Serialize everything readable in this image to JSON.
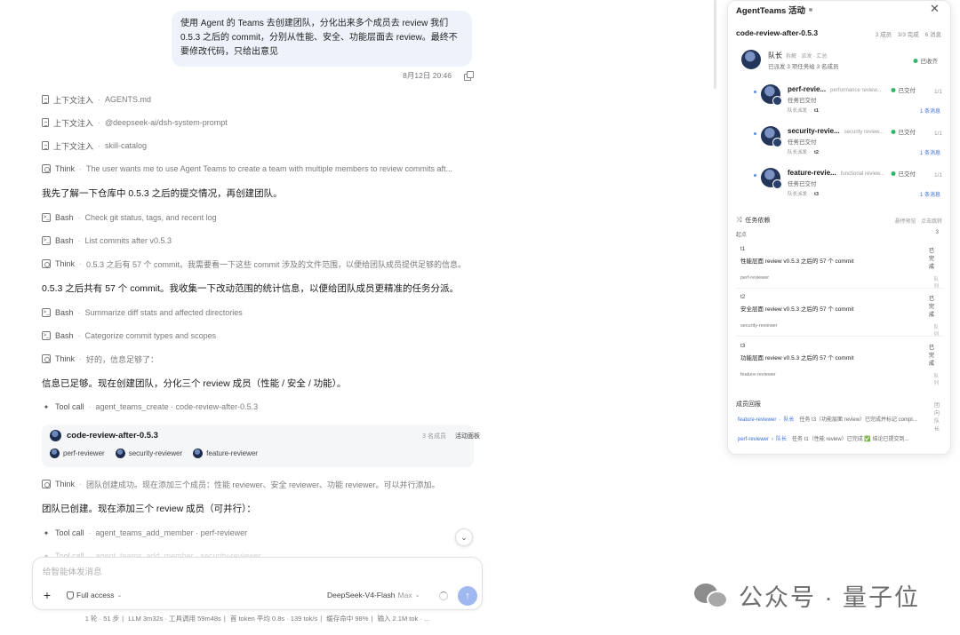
{
  "chat": {
    "user_message": "使用 Agent 的 Teams 去创建团队，分化出来多个成员去 review 我们 0.5.3 之后的 commit，分别从性能、安全、功能层面去 review。最终不要修改代码，只给出意见",
    "timestamp": "8月12日 20:46",
    "steps": [
      {
        "type": "context",
        "label": "上下文注入",
        "text": "AGENTS.md"
      },
      {
        "type": "context",
        "label": "上下文注入",
        "text": "@deepseek-ai/dsh-system-prompt"
      },
      {
        "type": "context",
        "label": "上下文注入",
        "text": "skill-catalog"
      },
      {
        "type": "think",
        "label": "Think",
        "text": "The user wants me to use Agent Teams to create a team with multiple members to review commits aft..."
      },
      {
        "type": "para",
        "text": "我先了解一下仓库中 0.5.3 之后的提交情况，再创建团队。"
      },
      {
        "type": "bash",
        "label": "Bash",
        "text": "Check git status, tags, and recent log"
      },
      {
        "type": "bash",
        "label": "Bash",
        "text": "List commits after v0.5.3"
      },
      {
        "type": "think",
        "label": "Think",
        "text": "0.5.3 之后有 57 个 commit。我需要看一下这些 commit 涉及的文件范围，以便给团队成员提供足够的信息。"
      },
      {
        "type": "para",
        "text": "0.5.3 之后共有 57 个 commit。我收集一下改动范围的统计信息，以便给团队成员更精准的任务分派。"
      },
      {
        "type": "bash",
        "label": "Bash",
        "text": "Summarize diff stats and affected directories"
      },
      {
        "type": "bash",
        "label": "Bash",
        "text": "Categorize commit types and scopes"
      },
      {
        "type": "think",
        "label": "Think",
        "text": "好的，信息足够了："
      },
      {
        "type": "para",
        "text": "信息已足够。现在创建团队，分化三个 review 成员（性能 / 安全 / 功能）。"
      },
      {
        "type": "tool",
        "label": "Tool call",
        "text": "agent_teams_create · code-review-after-0.5.3"
      },
      {
        "type": "think",
        "label": "Think",
        "text": "团队创建成功。现在添加三个成员：性能 reviewer、安全 reviewer、功能 reviewer。可以并行添加。"
      },
      {
        "type": "para",
        "text": "团队已创建。现在添加三个 review 成员（可并行）："
      },
      {
        "type": "tool",
        "label": "Tool call",
        "text": "agent_teams_add_member · perf-reviewer"
      },
      {
        "type": "tool",
        "label": "Tool call",
        "text": "agent_teams_add_member · security-reviewer"
      }
    ],
    "team_card": {
      "name": "code-review-after-0.5.3",
      "count": "3 名成员",
      "link": "活动面板",
      "members": [
        "perf-reviewer",
        "security-reviewer",
        "feature-reviewer"
      ]
    }
  },
  "composer": {
    "placeholder": "给智能体发消息",
    "access_label": "Full access",
    "model": "DeepSeek-V4-Flash",
    "tier": "Max"
  },
  "status_bar": {
    "items": [
      "1 轮 · 51 步",
      "LLM 3m32s · 工具调用 59m48s",
      "首 token 平均 0.8s · 139 tok/s",
      "缓存命中 98%",
      "输入 2.1M tok · ..."
    ]
  },
  "panel": {
    "title": "AgentTeams 活动",
    "team_name": "code-review-after-0.5.3",
    "team_stats": [
      "3 成员",
      "3/3 完成",
      "6 消息"
    ],
    "leader": {
      "name": "队长",
      "sub": "拆解 · 派发 · 汇总",
      "desc": "已派发 3 项任务给 3 名成员",
      "status": "已收齐"
    },
    "members": [
      {
        "name": "perf-revie...",
        "role": "performance review...",
        "status": "已交付",
        "ratio": "1/1",
        "state": "任务已交付",
        "meta": "队长派发",
        "task": "t1",
        "msgs": "1 条消息"
      },
      {
        "name": "security-revie...",
        "role": "security review...",
        "status": "已交付",
        "ratio": "1/1",
        "state": "任务已交付",
        "meta": "队长派发",
        "task": "t2",
        "msgs": "1 条消息"
      },
      {
        "name": "feature-revie...",
        "role": "functional review...",
        "status": "已交付",
        "ratio": "1/1",
        "state": "任务已交付",
        "meta": "队长派发",
        "task": "t3",
        "msgs": "1 条消息"
      }
    ],
    "deps": {
      "title": "任务依赖",
      "right": "悬停预览 · 点击跳转",
      "start": "起点",
      "start_count": "3",
      "tasks": [
        {
          "id": "t1",
          "status": "已完成",
          "title": "性能层面 review v0.5.3 之后的 57 个 commit",
          "owner": "perf-reviewer",
          "queue": "队列"
        },
        {
          "id": "t2",
          "status": "已完成",
          "title": "安全层面 review v0.5.3 之后的 57 个 commit",
          "owner": "security-reviewer",
          "queue": "队列"
        },
        {
          "id": "t3",
          "status": "已完成",
          "title": "功能层面 review v0.5.3 之后的 57 个 commit",
          "owner": "feature-reviewer",
          "queue": "队列"
        }
      ]
    },
    "reports": {
      "title": "成员回报",
      "right": "团向队长",
      "items": [
        {
          "who": "feature-reviewer",
          "arrow": "·",
          "lead": "队长",
          "text": "任务 t3（功能层面 review）已完成并标记 compl..."
        },
        {
          "who": "perf-reviewer",
          "arrow": "›",
          "lead": "队长",
          "text": "任务 t1（性能 review）已完成 ✅ 结论已提交到..."
        }
      ]
    }
  },
  "watermark": {
    "text": "公众号 · 量子位"
  }
}
